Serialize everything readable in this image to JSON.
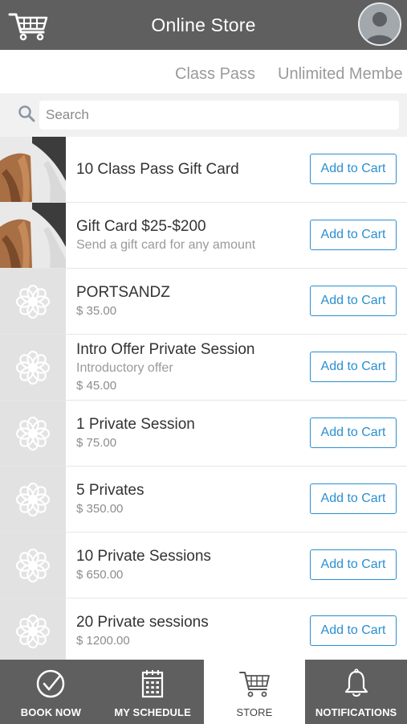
{
  "header": {
    "title": "Online Store",
    "cart_icon": "cart-icon",
    "avatar_icon": "user-avatar-icon"
  },
  "tabs": [
    {
      "label": "Class Pass"
    },
    {
      "label": "Unlimited Membe"
    }
  ],
  "search": {
    "placeholder": "Search",
    "value": ""
  },
  "items": [
    {
      "name": "10 Class Pass Gift Card",
      "subtitle": "",
      "price": "",
      "button": "Add to Cart",
      "thumb": "photo"
    },
    {
      "name": "Gift Card $25-$200",
      "subtitle": "Send a gift card for any amount",
      "price": "",
      "button": "Add to Cart",
      "thumb": "photo"
    },
    {
      "name": "PORTSANDZ",
      "subtitle": "",
      "price": "$ 35.00",
      "button": "Add to Cart",
      "thumb": "lotus-icon"
    },
    {
      "name": "Intro Offer Private Session",
      "subtitle": "Introductory offer",
      "price": "$ 45.00",
      "button": "Add to Cart",
      "thumb": "lotus-icon"
    },
    {
      "name": "1 Private Session",
      "subtitle": "",
      "price": "$ 75.00",
      "button": "Add to Cart",
      "thumb": "lotus-icon"
    },
    {
      "name": "5 Privates",
      "subtitle": "",
      "price": "$ 350.00",
      "button": "Add to Cart",
      "thumb": "lotus-icon"
    },
    {
      "name": "10 Private Sessions",
      "subtitle": "",
      "price": "$ 650.00",
      "button": "Add to Cart",
      "thumb": "lotus-icon"
    },
    {
      "name": "20 Private sessions",
      "subtitle": "",
      "price": "$ 1200.00",
      "button": "Add to Cart",
      "thumb": "lotus-icon"
    }
  ],
  "nav": [
    {
      "label": "BOOK NOW",
      "icon": "check-circle-icon",
      "active": false
    },
    {
      "label": "MY SCHEDULE",
      "icon": "calendar-icon",
      "active": false
    },
    {
      "label": "STORE",
      "icon": "cart-icon",
      "active": true
    },
    {
      "label": "NOTIFICATIONS",
      "icon": "bell-icon",
      "active": false
    }
  ],
  "colors": {
    "header_bg": "#5f5f5f",
    "accent": "#2a8fd0",
    "search_bg": "#f1f1f1"
  }
}
